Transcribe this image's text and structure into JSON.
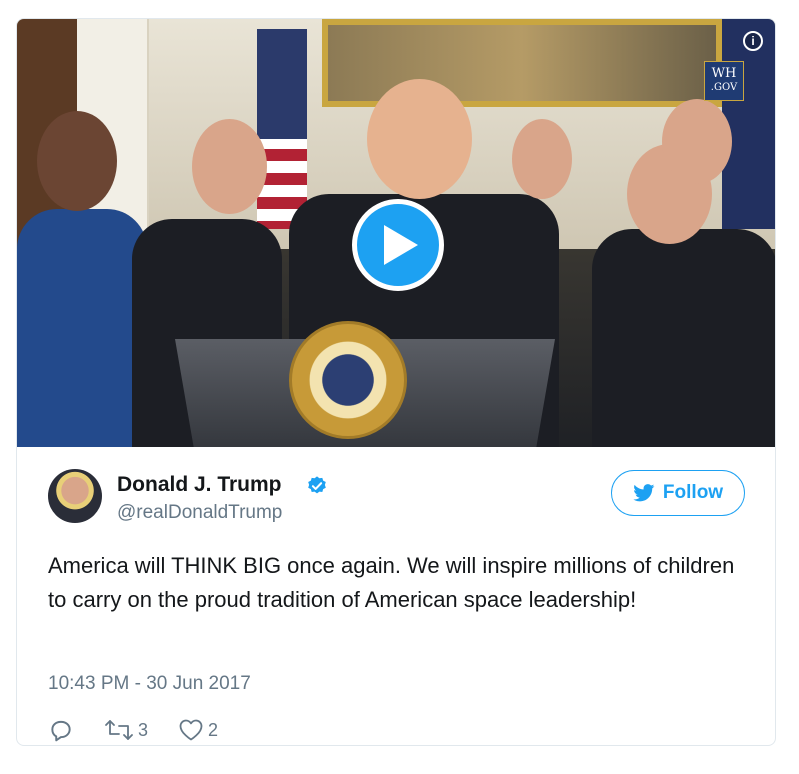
{
  "media": {
    "badge_line1": "WH",
    "badge_line2": ".GOV",
    "info_glyph": "i",
    "play_icon": "play-icon",
    "info_icon": "info-icon"
  },
  "author": {
    "name": "Donald J. Trump",
    "handle": "@realDonaldTrump",
    "verified_icon": "verified-icon"
  },
  "follow_button": {
    "label": "Follow",
    "icon": "twitter-bird-icon"
  },
  "tweet": {
    "text": "America will THINK BIG once again. We will inspire millions of children to carry on the proud tradition of American space leadership!",
    "timestamp": "10:43 PM - 30 Jun 2017"
  },
  "actions": {
    "reply_icon": "reply-icon",
    "retweet_icon": "retweet-icon",
    "retweet_count": "3",
    "like_icon": "heart-icon",
    "like_count": "2"
  },
  "colors": {
    "accent": "#1da1f2",
    "secondary_text": "#657786",
    "border": "#e1e8ed"
  }
}
